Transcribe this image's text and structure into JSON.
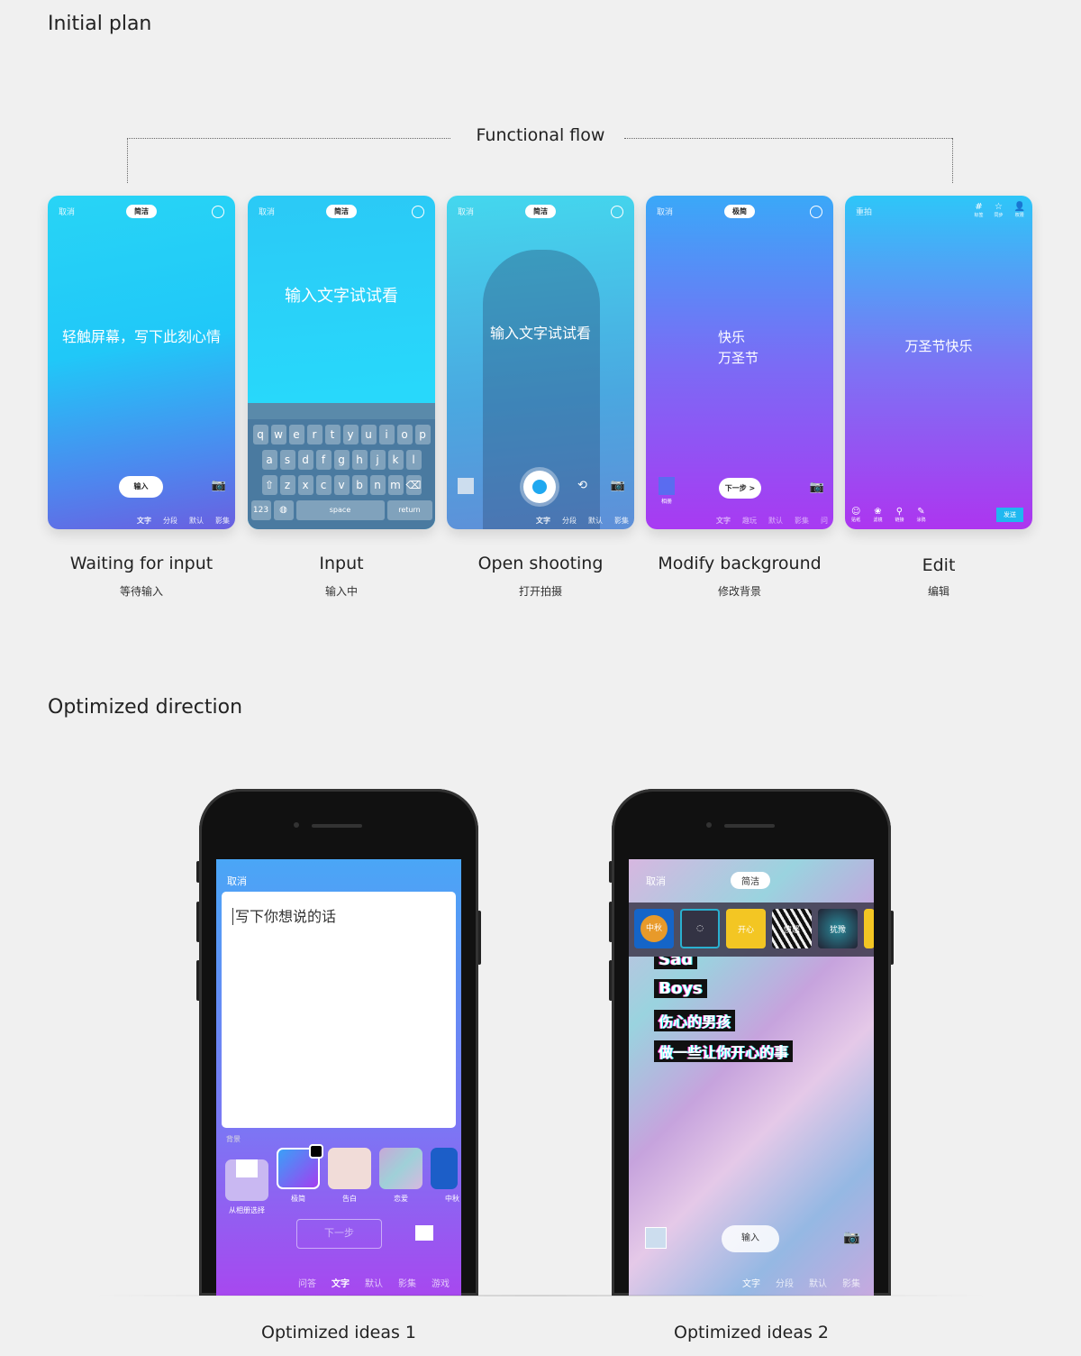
{
  "sections": {
    "initial": "Initial plan",
    "flow": "Functional flow",
    "optimized": "Optimized direction"
  },
  "common": {
    "cancel": "取消",
    "style": "简洁",
    "input_btn": "输入",
    "tabs": [
      "文字",
      "分段",
      "默认",
      "影集"
    ]
  },
  "screens": [
    {
      "title": "Waiting for input",
      "subtitle": "等待输入",
      "message": "轻触屏幕，写下此刻心情"
    },
    {
      "title": "Input",
      "subtitle": "输入中",
      "message": "输入文字试试看",
      "keys": [
        [
          "q",
          "w",
          "e",
          "r",
          "t",
          "y",
          "u",
          "i",
          "o",
          "p"
        ],
        [
          "a",
          "s",
          "d",
          "f",
          "g",
          "h",
          "j",
          "k",
          "l"
        ],
        [
          "⇧",
          "z",
          "x",
          "c",
          "v",
          "b",
          "n",
          "m",
          "⌫"
        ]
      ],
      "k123": "123",
      "space": "space",
      "return": "return"
    },
    {
      "title": "Open shooting",
      "subtitle": "打开拍摄",
      "message": "输入文字试试看"
    },
    {
      "title": "Modify background",
      "subtitle": "修改背景",
      "style": "极简",
      "line1": "快乐",
      "line2": "万圣节",
      "next": "下一步 >",
      "album": "相册",
      "tabs": [
        "文字",
        "趣玩",
        "默认",
        "影集",
        "问"
      ]
    },
    {
      "title": "Edit",
      "subtitle": "编辑",
      "retake": "重拍",
      "message": "万圣节快乐",
      "top_icons": [
        "标签",
        "同步",
        "权限"
      ],
      "bottom_icons": [
        "贴纸",
        "滤镜",
        "链接",
        "涂鸦"
      ],
      "send": "发送"
    }
  ],
  "idea1": {
    "caption": "Optimized ideas 1",
    "cancel": "取消",
    "placeholder": "写下你想说的话",
    "bg_label": "背景",
    "swatches": [
      "从相册选择",
      "极简",
      "告白",
      "恋爱",
      "中秋"
    ],
    "next": "下一步",
    "tabs": [
      "问答",
      "文字",
      "默认",
      "影集",
      "游戏"
    ]
  },
  "idea2": {
    "caption": "Optimized ideas 2",
    "cancel": "取消",
    "style": "简洁",
    "thumbs": [
      "中秋",
      "",
      "开心",
      "愤怒",
      "犹豫"
    ],
    "lines": [
      "Sad",
      "Boys",
      "伤心的男孩",
      "做一些让你开心的事"
    ],
    "input": "输入",
    "tabs": [
      "文字",
      "分段",
      "默认",
      "影集"
    ]
  }
}
